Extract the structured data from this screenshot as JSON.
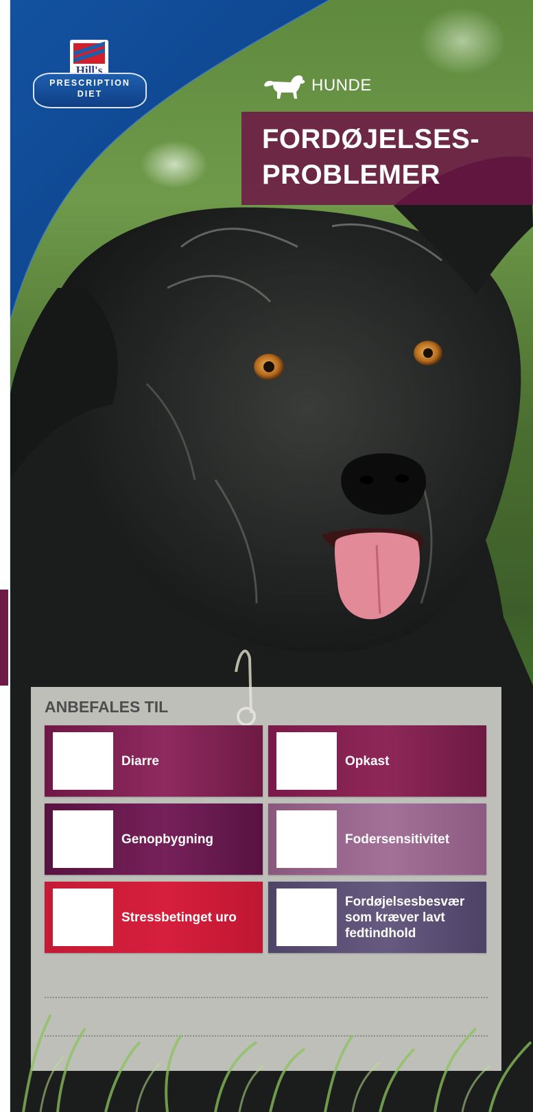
{
  "brand": {
    "logo_name": "Hill's",
    "line1": "PRESCRIPTION",
    "line2": "DIET"
  },
  "species": {
    "icon": "dog-icon",
    "label": "HUNDE"
  },
  "title": {
    "line1": "FORDØJELSES-",
    "line2": "PROBLEMER"
  },
  "panel": {
    "heading": "ANBEFALES TIL",
    "items": [
      {
        "label": "Diarre",
        "color": "#7d1f50"
      },
      {
        "label": "Opkast",
        "color": "#7d1f50"
      },
      {
        "label": "Genopbygning",
        "color": "#62184a"
      },
      {
        "label": "Fodersensitivitet",
        "color": "#956587"
      },
      {
        "label": "Stressbetinget uro",
        "color": "#cc1c38"
      },
      {
        "label": "Fordøjelsesbesvær som kræver lavt fedtindhold",
        "color": "#5a4e74"
      }
    ]
  },
  "colors": {
    "brand_blue": "#1352a0",
    "title_magenta": "#6e1646",
    "panel_bg": "#e8e8e2"
  }
}
